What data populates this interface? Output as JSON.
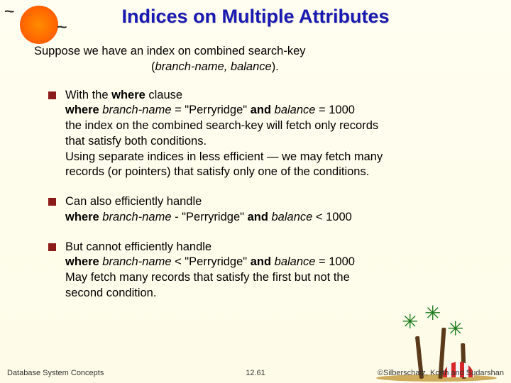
{
  "title": "Indices on Multiple Attributes",
  "intro": {
    "line1": "Suppose we have an index on combined search-key",
    "line2_open": "(",
    "line2_key": "branch-name, balance",
    "line2_close": ")."
  },
  "bullets": [
    {
      "l1a": "With the ",
      "l1b": "where",
      "l1c": " clause",
      "l2a": "where",
      "l2b": " branch-name ",
      "l2c": "= \"Perryridge\" ",
      "l2d": "and",
      "l2e": " balance ",
      "l2f": "= 1000",
      "l3": "the index on the combined search-key will fetch only records",
      "l4": "that satisfy both conditions.",
      "l5": "Using separate indices in less efficient — we may fetch many",
      "l6": "records (or pointers) that satisfy only one of the conditions."
    },
    {
      "l1": "Can also efficiently handle",
      "l2a": "where",
      "l2b": " branch-name ",
      "l2c": "- \"Perryridge\" ",
      "l2d": "and",
      "l2e": " balance ",
      "l2f": "< 1000"
    },
    {
      "l1": "But cannot efficiently handle",
      "l2a": "where",
      "l2b": " branch-name ",
      "l2c": "< \"Perryridge\" ",
      "l2d": "and",
      "l2e": " balance ",
      "l2f": "= 1000",
      "l3": "May fetch many records that satisfy the first but not the",
      "l4": "second condition."
    }
  ],
  "footer": {
    "left": "Database System Concepts",
    "center": "12.61",
    "right": "©Silberschatz, Korth and Sudarshan"
  }
}
